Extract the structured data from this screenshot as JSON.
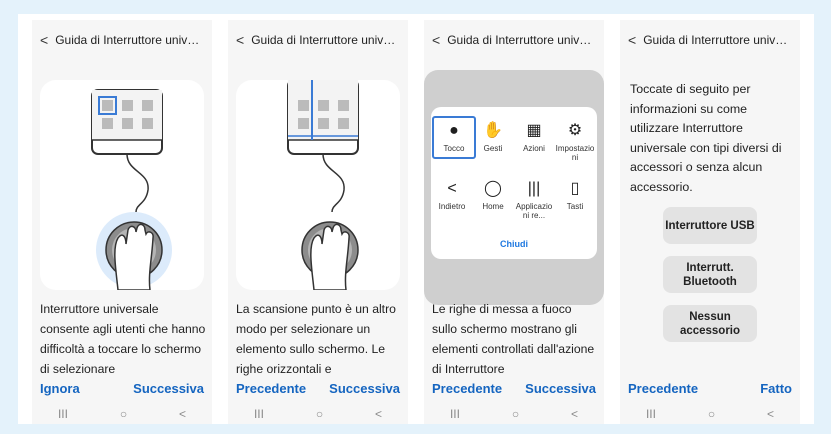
{
  "screens": [
    {
      "header": "Guida di Interruttore univers...",
      "body": "Interruttore universale consente agli utenti che hanno difficoltà a toccare lo schermo di selezionare",
      "left_action": "Ignora",
      "right_action": "Successiva"
    },
    {
      "header": "Guida di Interruttore univers...",
      "body": "La scansione punto è un altro modo per selezionare un elemento sullo schermo. Le righe orizzontali e",
      "left_action": "Precedente",
      "right_action": "Successiva"
    },
    {
      "header": "Guida di Interruttore univers...",
      "body": "Le righe di messa a fuoco sullo schermo mostrano gli elementi controllati dall'azione di Interruttore",
      "left_action": "Precedente",
      "right_action": "Successiva",
      "panel": {
        "items": [
          {
            "label": "Tocco",
            "icon": "●"
          },
          {
            "label": "Gesti",
            "icon": "✋"
          },
          {
            "label": "Azioni",
            "icon": "▦"
          },
          {
            "label": "Impostazioni",
            "icon": "⚙"
          },
          {
            "label": "Indietro",
            "icon": "<"
          },
          {
            "label": "Home",
            "icon": "◯"
          },
          {
            "label": "Applicazioni re...",
            "icon": "|||"
          },
          {
            "label": "Tasti",
            "icon": "▯"
          }
        ],
        "close": "Chiudi"
      }
    },
    {
      "header": "Guida di Interruttore univers...",
      "body": "Toccate di seguito per informazioni su come utilizzare Interruttore universale con tipi diversi di accessori o senza alcun accessorio.",
      "left_action": "Precedente",
      "right_action": "Fatto",
      "accessories": [
        "Interruttore USB",
        "Interrutt. Bluetooth",
        "Nessun accessorio"
      ]
    }
  ],
  "nav": {
    "recents": "III",
    "home": "○",
    "back": "<"
  },
  "colors": {
    "accent": "#1565c0",
    "highlight": "#3a7bd5",
    "background": "#e4f2fb"
  }
}
